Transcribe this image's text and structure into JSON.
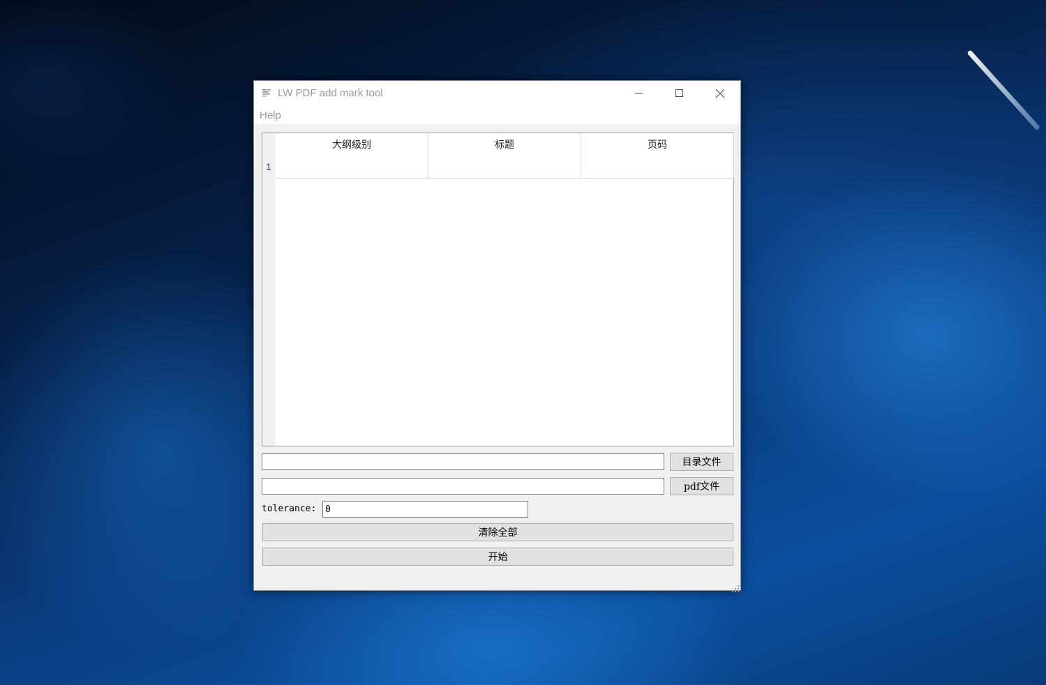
{
  "window": {
    "title": "LW PDF add mark tool"
  },
  "menu": {
    "help": "Help"
  },
  "table": {
    "columns": [
      "大纲级别",
      "标题",
      "页码"
    ],
    "rows": [
      "1"
    ]
  },
  "inputs": {
    "toc_file_value": "",
    "pdf_file_value": "",
    "tolerance_value": "0"
  },
  "buttons": {
    "toc_file": "目录文件",
    "pdf_file": "pdf文件",
    "clear_all": "清除全部",
    "start": "开始"
  },
  "labels": {
    "tolerance": "tolerance:"
  },
  "icons": {
    "app": "document-icon",
    "minimize": "minimize-icon",
    "maximize": "maximize-icon",
    "close": "close-icon",
    "resize": "resize-grip-icon"
  }
}
